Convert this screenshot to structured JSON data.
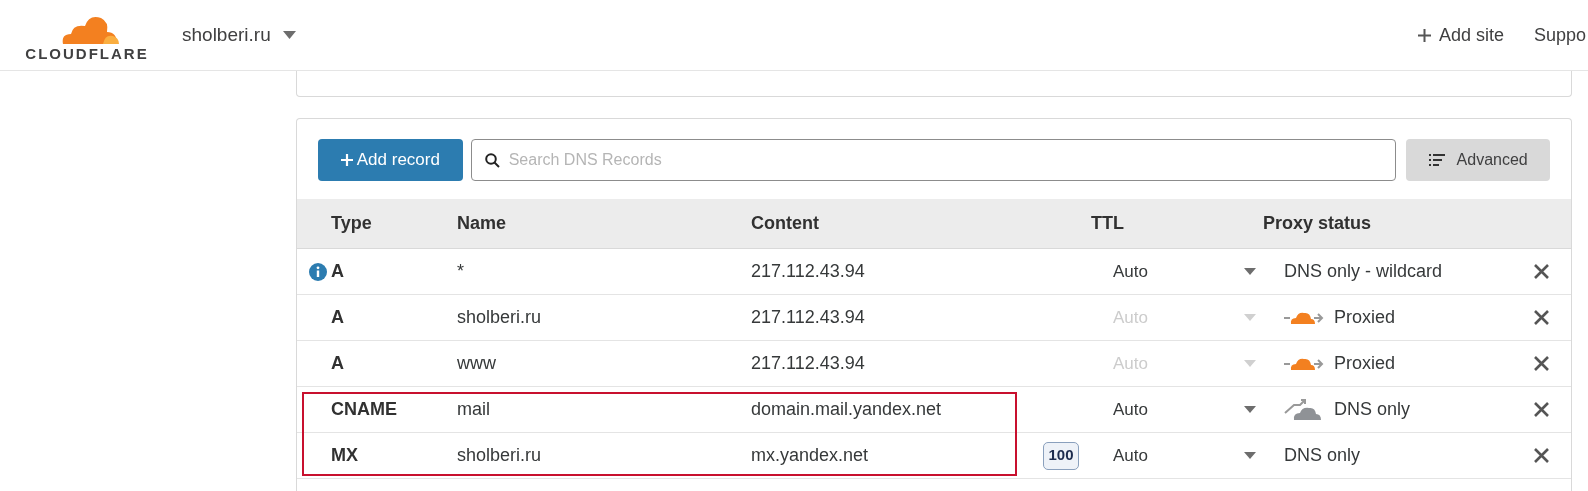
{
  "header": {
    "logo_text": "CLOUDFLARE",
    "site": "sholberi.ru",
    "add_site": "Add site",
    "support": "Suppo"
  },
  "toolbar": {
    "add_record": "Add record",
    "search_placeholder": "Search DNS Records",
    "advanced": "Advanced"
  },
  "table": {
    "columns": [
      "Type",
      "Name",
      "Content",
      "TTL",
      "Proxy status"
    ],
    "rows": [
      {
        "info": true,
        "type": "A",
        "name": "*",
        "content": "217.112.43.94",
        "ttl": "Auto",
        "ttl_disabled": false,
        "kind": "none",
        "proxy_label": "DNS only - wildcard",
        "highlighted": false
      },
      {
        "info": false,
        "type": "A",
        "name": "sholberi.ru",
        "content": "217.112.43.94",
        "ttl": "Auto",
        "ttl_disabled": true,
        "kind": "proxied",
        "proxy_label": "Proxied",
        "highlighted": false
      },
      {
        "info": false,
        "type": "A",
        "name": "www",
        "content": "217.112.43.94",
        "ttl": "Auto",
        "ttl_disabled": true,
        "kind": "proxied",
        "proxy_label": "Proxied",
        "highlighted": false
      },
      {
        "info": false,
        "type": "CNAME",
        "name": "mail",
        "content": "domain.mail.yandex.net",
        "ttl": "Auto",
        "ttl_disabled": false,
        "kind": "dns_only",
        "proxy_label": "DNS only",
        "highlighted": true
      },
      {
        "info": false,
        "type": "MX",
        "name": "sholberi.ru",
        "content": "mx.yandex.net",
        "priority": "100",
        "ttl": "Auto",
        "ttl_disabled": false,
        "kind": "none",
        "proxy_label": "DNS only",
        "highlighted": true
      }
    ]
  }
}
